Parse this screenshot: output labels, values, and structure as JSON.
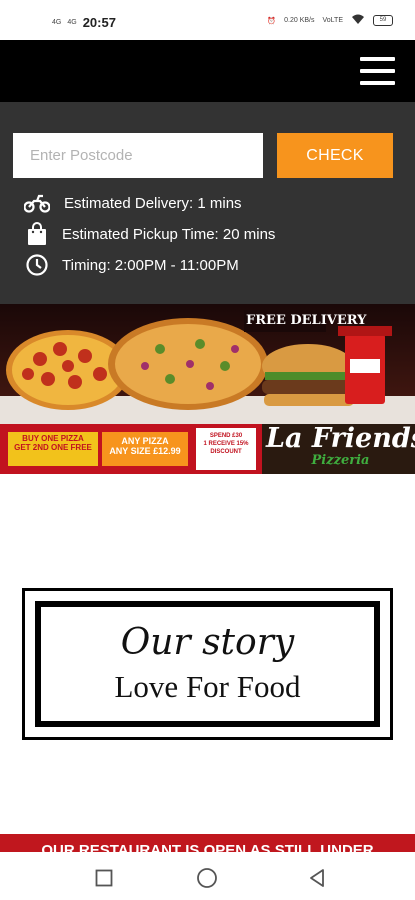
{
  "status_bar": {
    "time": "20:57",
    "signal_left": "4G",
    "signal_right": "4G",
    "net_speed_1": "0.20 KB/s",
    "net_speed_2": "VoLTE",
    "battery": "59"
  },
  "header": {
    "menu_icon": "hamburger-menu-icon"
  },
  "checker": {
    "postcode_placeholder": "Enter Postcode",
    "postcode_value": "",
    "check_label": "CHECK"
  },
  "info": {
    "delivery": "Estimated Delivery: 1 mins",
    "pickup": "Estimated Pickup Time: 20 mins",
    "timing": "Timing: 2:00PM - 11:00PM"
  },
  "banner": {
    "free_delivery": "FREE DELIVERY",
    "brand_line1": "La Friends",
    "brand_line2": "Pizzeria",
    "promo1_line1": "BUY ONE PIZZA",
    "promo1_line2": "GET 2ND ONE FREE",
    "promo2_line1": "ANY PIZZA",
    "promo2_line2": "ANY SIZE £12.99",
    "promo3_line1": "SPEND £30",
    "promo3_line2": "1 RECEIVE 15%",
    "promo3_line3": "DISCOUNT"
  },
  "story": {
    "title": "Our story",
    "subtitle": "Love For Food"
  },
  "notice": {
    "text": "OUR RESTAURANT IS OPEN AS STILL UNDER"
  },
  "colors": {
    "accent": "#f7941d",
    "panel": "#333333",
    "topbar": "#000000",
    "notice_red": "#c0171e"
  }
}
